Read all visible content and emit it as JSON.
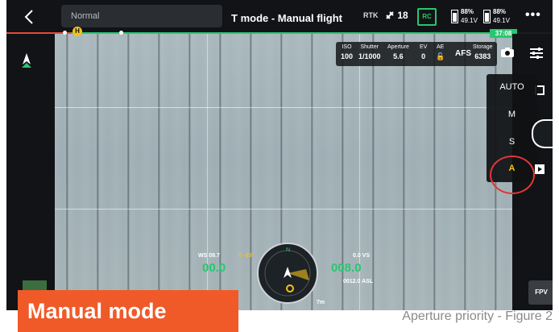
{
  "topbar": {
    "back_icon": "chevron-left-icon",
    "status_text": "Normal",
    "mode_title": "T mode - Manual flight",
    "rtk_label": "RTK",
    "satellite_count": "18",
    "rc_label": "RC",
    "battery_1": {
      "percent": "88%",
      "voltage": "49.1V",
      "level": 0.88
    },
    "battery_2": {
      "percent": "88%",
      "voltage": "49.1V",
      "level": 0.88
    },
    "more_icon": "more-dots-icon"
  },
  "timeline": {
    "home_marker": "H",
    "flight_time": "37:08"
  },
  "camera_params": {
    "iso_label": "ISO",
    "iso_value": "100",
    "shutter_label": "Shutter",
    "shutter_value": "1/1000",
    "aperture_label": "Aperture",
    "aperture_value": "5.6",
    "ev_label": "EV",
    "ev_value": "0",
    "ae_label": "AE",
    "ae_icon": "unlock-icon",
    "afs_label": "AFS",
    "storage_label": "Storage",
    "storage_value": "6383"
  },
  "mode_menu": {
    "items": [
      "AUTO",
      "M",
      "S",
      "A"
    ],
    "selected": "A"
  },
  "telemetry": {
    "ws_label": "WS 09.7",
    "ws_warning": "T -90°",
    "horizontal_speed": "00.0",
    "vs_label": "0.0 VS",
    "altitude": "008.0",
    "asl": "0012.0 ASL",
    "distance": "7m"
  },
  "right_rail": {
    "fpv_label": "FPV"
  },
  "overlay": {
    "banner": "Manual mode",
    "caption": "Aperture priority - Figure 2"
  },
  "colors": {
    "accent_green": "#28c76f",
    "highlight_yellow": "#f3c21b",
    "annotation_red": "#e23636",
    "banner_orange": "#f05a28"
  }
}
